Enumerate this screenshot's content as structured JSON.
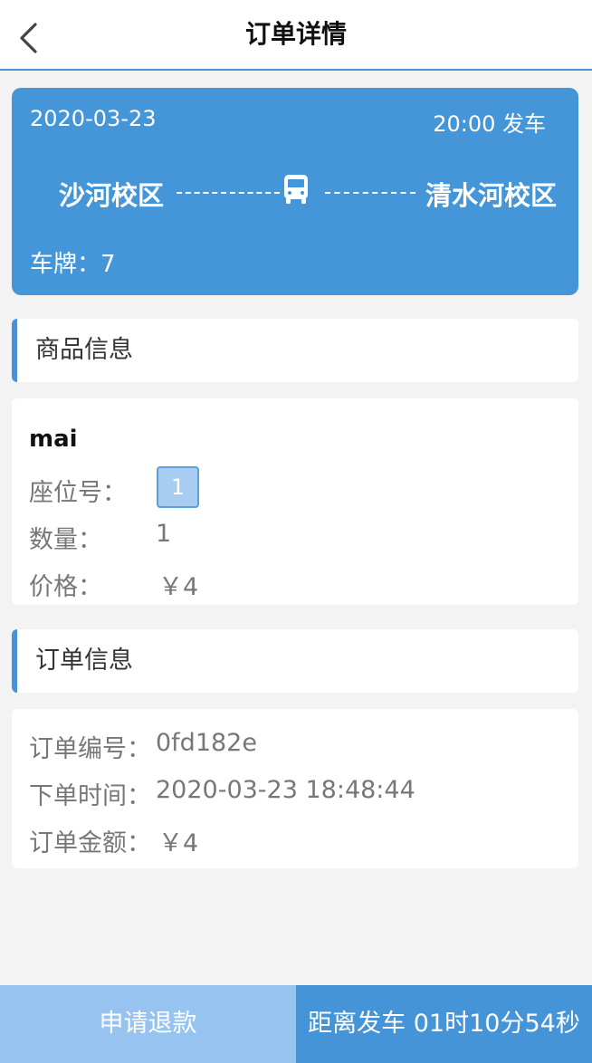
{
  "header": {
    "title": "订单详情",
    "back_icon": "chevron-left-icon"
  },
  "trip": {
    "date": "2020-03-23",
    "departure": "20:00 发车",
    "from": "沙河校区",
    "to": "清水河校区",
    "plate_label": "车牌：",
    "plate_value": "7",
    "bus_icon": "bus-icon"
  },
  "goods_section": {
    "title": "商品信息"
  },
  "goods": {
    "name": "mai",
    "seat_label": "座位号：",
    "seat_value": "1",
    "qty_label": "数量：",
    "qty_value": "1",
    "price_label": "价格：",
    "price_value": "￥4"
  },
  "order_section": {
    "title": "订单信息"
  },
  "order": {
    "number_label": "订单编号：",
    "number_value": "0fd182e",
    "time_label": "下单时间：",
    "time_value": "2020-03-23 18:48:44",
    "amount_label": "订单金额：",
    "amount_value": "￥4"
  },
  "footer": {
    "refund_label": "申请退款",
    "countdown_text": "距离发车 01时10分54秒"
  },
  "colors": {
    "accent": "#4496d8",
    "refund_button": "#96c3ef",
    "background": "#f3f3f3"
  }
}
